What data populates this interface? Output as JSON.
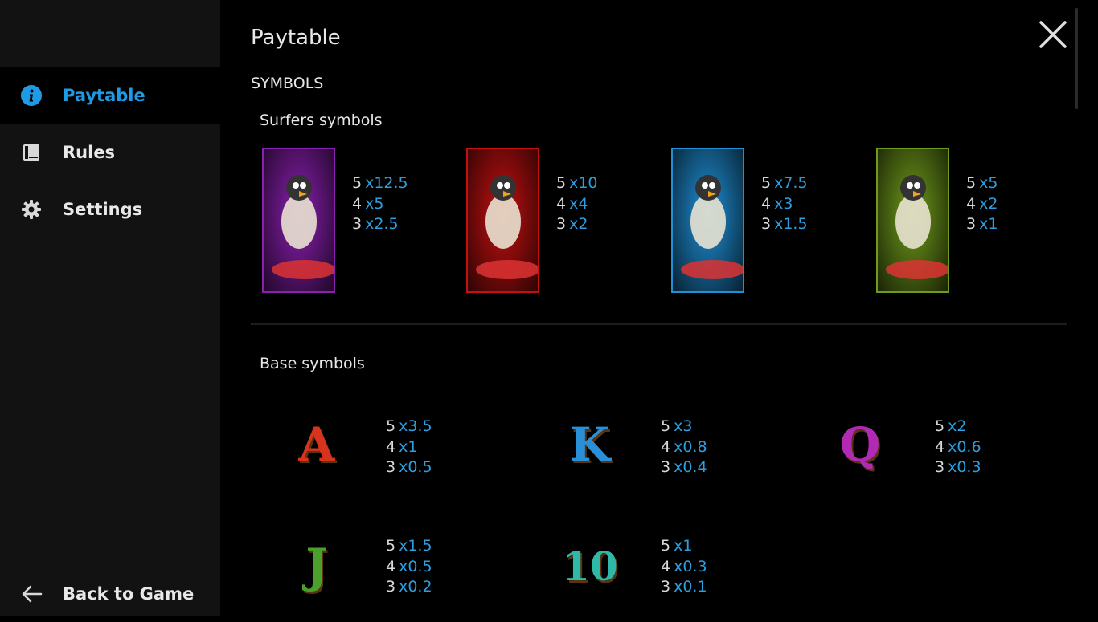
{
  "sidebar": {
    "items": [
      {
        "label": "Paytable",
        "icon": "info-icon",
        "active": true
      },
      {
        "label": "Rules",
        "icon": "book-icon",
        "active": false
      },
      {
        "label": "Settings",
        "icon": "gear-icon",
        "active": false
      }
    ],
    "back_label": "Back to Game"
  },
  "header": {
    "title": "Paytable",
    "section": "SYMBOLS"
  },
  "surfers": {
    "title": "Surfers symbols",
    "symbols": [
      {
        "name": "penguin-surfer",
        "bg": "#8b1fb0",
        "pays": [
          {
            "count": "5",
            "mult": "x12.5"
          },
          {
            "count": "4",
            "mult": "x5"
          },
          {
            "count": "3",
            "mult": "x2.5"
          }
        ]
      },
      {
        "name": "parrot-surfer",
        "bg": "#c41010",
        "pays": [
          {
            "count": "5",
            "mult": "x10"
          },
          {
            "count": "4",
            "mult": "x4"
          },
          {
            "count": "3",
            "mult": "x2"
          }
        ]
      },
      {
        "name": "eagle-surfer",
        "bg": "#1f8fd6",
        "pays": [
          {
            "count": "5",
            "mult": "x7.5"
          },
          {
            "count": "4",
            "mult": "x3"
          },
          {
            "count": "3",
            "mult": "x1.5"
          }
        ]
      },
      {
        "name": "vulture-surfer",
        "bg": "#6f9a1a",
        "pays": [
          {
            "count": "5",
            "mult": "x5"
          },
          {
            "count": "4",
            "mult": "x2"
          },
          {
            "count": "3",
            "mult": "x1"
          }
        ]
      }
    ]
  },
  "base": {
    "title": "Base symbols",
    "symbols": [
      {
        "glyph": "A",
        "color": "#d8331e",
        "pays": [
          {
            "count": "5",
            "mult": "x3.5"
          },
          {
            "count": "4",
            "mult": "x1"
          },
          {
            "count": "3",
            "mult": "x0.5"
          }
        ]
      },
      {
        "glyph": "K",
        "color": "#2a8fd6",
        "pays": [
          {
            "count": "5",
            "mult": "x3"
          },
          {
            "count": "4",
            "mult": "x0.8"
          },
          {
            "count": "3",
            "mult": "x0.4"
          }
        ]
      },
      {
        "glyph": "Q",
        "color": "#b02ab4",
        "pays": [
          {
            "count": "5",
            "mult": "x2"
          },
          {
            "count": "4",
            "mult": "x0.6"
          },
          {
            "count": "3",
            "mult": "x0.3"
          }
        ]
      },
      {
        "glyph": "J",
        "color": "#4aa02a",
        "pays": [
          {
            "count": "5",
            "mult": "x1.5"
          },
          {
            "count": "4",
            "mult": "x0.5"
          },
          {
            "count": "3",
            "mult": "x0.2"
          }
        ]
      },
      {
        "glyph": "10",
        "color": "#2fb8a8",
        "pays": [
          {
            "count": "5",
            "mult": "x1"
          },
          {
            "count": "4",
            "mult": "x0.3"
          },
          {
            "count": "3",
            "mult": "x0.1"
          }
        ]
      }
    ]
  },
  "colors": {
    "accent": "#1e9be6",
    "multiplier": "#2c9fe0",
    "sidebar_bg": "#121212"
  }
}
